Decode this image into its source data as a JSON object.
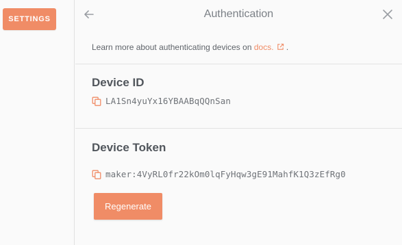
{
  "sidebar": {
    "settings_label": "SETTINGS"
  },
  "header": {
    "title": "Authentication",
    "back_icon": "arrow-left-icon",
    "close_icon": "close-icon"
  },
  "info": {
    "prefix": "Learn more about authenticating devices on",
    "link_text": "docs.",
    "suffix": "."
  },
  "device_id": {
    "label": "Device ID",
    "value": "LA1Sn4yuYx16YBAABqQQnSan",
    "icon": "copy-icon"
  },
  "device_token": {
    "label": "Device Token",
    "value": "maker:4VyRL0fr22kOm0lqFyHqw3gE91MahfK1Q3zEfRg0",
    "icon": "copy-icon"
  },
  "actions": {
    "regenerate_label": "Regenerate"
  },
  "colors": {
    "accent": "#f08c66",
    "title_gray": "#7b8086",
    "heading": "#51565c",
    "divider": "#e3e3e3"
  }
}
